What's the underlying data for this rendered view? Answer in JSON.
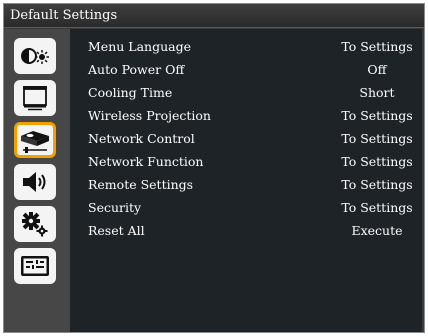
{
  "title": "Default Settings",
  "tabs": [
    {
      "icon": "picture-brightness-icon",
      "selected": false
    },
    {
      "icon": "screen-icon",
      "selected": false
    },
    {
      "icon": "projector-icon",
      "selected": true
    },
    {
      "icon": "speaker-icon",
      "selected": false
    },
    {
      "icon": "gears-icon",
      "selected": false
    },
    {
      "icon": "option-panel-icon",
      "selected": false
    }
  ],
  "menu": [
    {
      "label": "Menu Language",
      "value": "To Settings"
    },
    {
      "label": "Auto Power Off",
      "value": "Off"
    },
    {
      "label": "Cooling Time",
      "value": "Short"
    },
    {
      "label": "Wireless Projection",
      "value": "To Settings"
    },
    {
      "label": "Network Control",
      "value": "To Settings"
    },
    {
      "label": "Network Function",
      "value": "To Settings"
    },
    {
      "label": "Remote Settings",
      "value": "To Settings"
    },
    {
      "label": "Security",
      "value": "To Settings"
    },
    {
      "label": "Reset All",
      "value": "Execute"
    }
  ],
  "colors": {
    "accent": "#f0a000",
    "panel": "#1e2328",
    "sidebar": "#474747"
  }
}
